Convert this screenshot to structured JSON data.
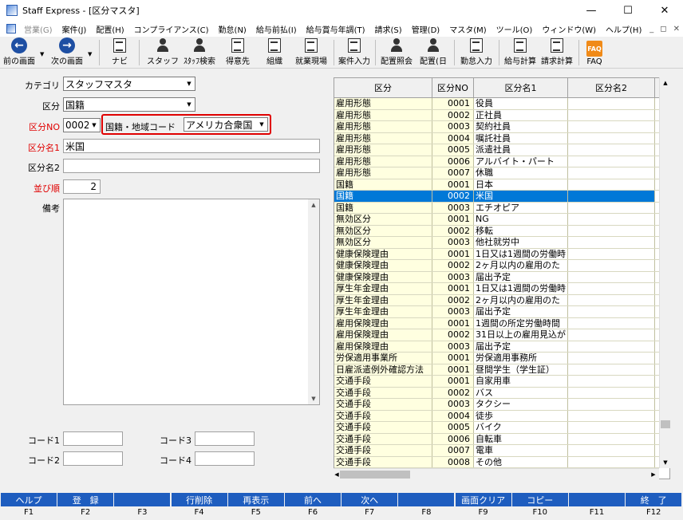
{
  "window": {
    "title": "Staff Express - [区分マスタ]"
  },
  "menu": [
    "営業(G)",
    "案件(J)",
    "配置(H)",
    "コンプライアンス(C)",
    "勤怠(N)",
    "給与前払(I)",
    "給与賞与年調(T)",
    "請求(S)",
    "管理(D)",
    "マスタ(M)",
    "ツール(O)",
    "ウィンドウ(W)",
    "ヘルプ(H)"
  ],
  "toolbar": [
    "前の画面",
    "次の画面",
    "ナビ",
    "スタッフ",
    "ｽﾀｯﾌ検索",
    "得意先",
    "組織",
    "就業現場",
    "案件入力",
    "配置照会",
    "配置(日",
    "勤怠入力",
    "給与計算",
    "請求計算",
    "FAQ"
  ],
  "form": {
    "category_label": "カテゴリ",
    "category_value": "スタッフマスタ",
    "kubun_label": "区分",
    "kubun_value": "国籍",
    "kubun_no_label": "区分NO",
    "kubun_no_value": "0002",
    "country_label": "国籍・地域コード",
    "country_value": "アメリカ合衆国",
    "name1_label": "区分名1",
    "name1_value": "米国",
    "name2_label": "区分名2",
    "name2_value": "",
    "order_label": "並び順",
    "order_value": "2",
    "memo_label": "備考",
    "code1_label": "コード1",
    "code2_label": "コード2",
    "code3_label": "コード3",
    "code4_label": "コード4"
  },
  "grid": {
    "headers": [
      "区分",
      "区分NO",
      "区分名1",
      "区分名2"
    ],
    "selected_index": 8,
    "rows": [
      [
        "雇用形態",
        "0001",
        "役員"
      ],
      [
        "雇用形態",
        "0002",
        "正社員"
      ],
      [
        "雇用形態",
        "0003",
        "契約社員"
      ],
      [
        "雇用形態",
        "0004",
        "嘱託社員"
      ],
      [
        "雇用形態",
        "0005",
        "派遣社員"
      ],
      [
        "雇用形態",
        "0006",
        "アルバイト・パート"
      ],
      [
        "雇用形態",
        "0007",
        "休職"
      ],
      [
        "国籍",
        "0001",
        "日本"
      ],
      [
        "国籍",
        "0002",
        "米国"
      ],
      [
        "国籍",
        "0003",
        "エチオピア"
      ],
      [
        "無効区分",
        "0001",
        "NG"
      ],
      [
        "無効区分",
        "0002",
        "移転"
      ],
      [
        "無効区分",
        "0003",
        "他社就労中"
      ],
      [
        "健康保険理由",
        "0001",
        "1日又は1週間の労働時"
      ],
      [
        "健康保険理由",
        "0002",
        "2ヶ月以内の雇用のた"
      ],
      [
        "健康保険理由",
        "0003",
        "届出予定"
      ],
      [
        "厚生年金理由",
        "0001",
        "1日又は1週間の労働時"
      ],
      [
        "厚生年金理由",
        "0002",
        "2ヶ月以内の雇用のた"
      ],
      [
        "厚生年金理由",
        "0003",
        "届出予定"
      ],
      [
        "雇用保険理由",
        "0001",
        "1週間の所定労働時間"
      ],
      [
        "雇用保険理由",
        "0002",
        "31日以上の雇用見込が"
      ],
      [
        "雇用保険理由",
        "0003",
        "届出予定"
      ],
      [
        "労保適用事業所",
        "0001",
        "労保適用事務所"
      ],
      [
        "日雇派遣例外確認方法",
        "0001",
        "昼間学生（学生証）"
      ],
      [
        "交通手段",
        "0001",
        "自家用車"
      ],
      [
        "交通手段",
        "0002",
        "バス"
      ],
      [
        "交通手段",
        "0003",
        "タクシー"
      ],
      [
        "交通手段",
        "0004",
        "徒歩"
      ],
      [
        "交通手段",
        "0005",
        "バイク"
      ],
      [
        "交通手段",
        "0006",
        "自転車"
      ],
      [
        "交通手段",
        "0007",
        "電車"
      ],
      [
        "交通手段",
        "0008",
        "その他"
      ]
    ]
  },
  "fkeys": [
    {
      "label": "ヘルプ",
      "key": "F1"
    },
    {
      "label": "登　録",
      "key": "F2"
    },
    {
      "label": "",
      "key": "F3"
    },
    {
      "label": "行削除",
      "key": "F4"
    },
    {
      "label": "再表示",
      "key": "F5"
    },
    {
      "label": "前へ",
      "key": "F6"
    },
    {
      "label": "次へ",
      "key": "F7"
    },
    {
      "label": "",
      "key": "F8"
    },
    {
      "label": "画面クリア",
      "key": "F9"
    },
    {
      "label": "コピー",
      "key": "F10"
    },
    {
      "label": "",
      "key": "F11"
    },
    {
      "label": "終　了",
      "key": "F12"
    }
  ]
}
